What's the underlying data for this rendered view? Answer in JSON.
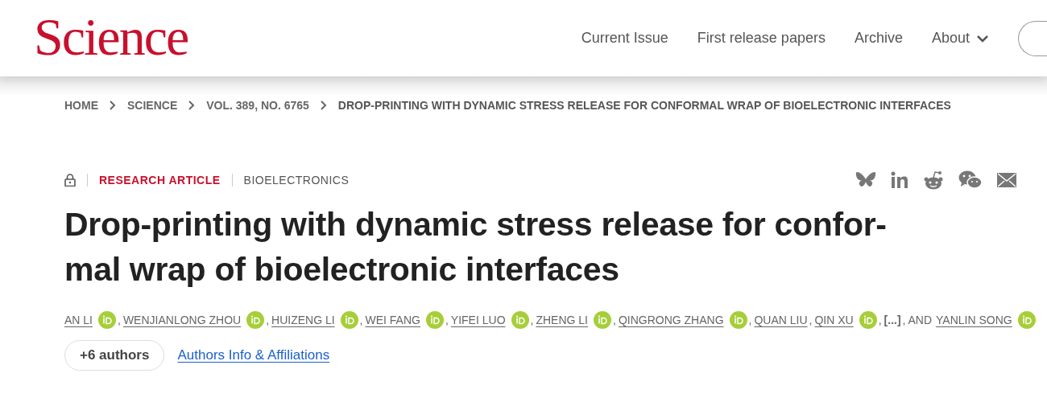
{
  "header": {
    "logo": "Science",
    "nav": [
      {
        "label": "Current Issue",
        "dropdown": false
      },
      {
        "label": "First release papers",
        "dropdown": false
      },
      {
        "label": "Archive",
        "dropdown": false
      },
      {
        "label": "About",
        "dropdown": true
      }
    ]
  },
  "breadcrumb": [
    "HOME",
    "SCIENCE",
    "VOL. 389, NO. 6765",
    "DROP-PRINTING WITH DYNAMIC STRESS RELEASE FOR CONFORMAL WRAP OF BIOELECTRONIC INTERFACES"
  ],
  "article": {
    "locked": true,
    "type": "RESEARCH ARTICLE",
    "section": "BIOELECTRONICS",
    "share": [
      {
        "kind": "bluesky"
      },
      {
        "kind": "linkedin"
      },
      {
        "kind": "reddit"
      },
      {
        "kind": "wechat"
      },
      {
        "kind": "email"
      }
    ],
    "title_lines": [
      "Drop-printing with dynamic stress release for confor-",
      "mal wrap of bioelectronic interfaces"
    ],
    "authors": [
      {
        "kind": "author",
        "name": "AN LI",
        "orcid": true,
        "sep": ","
      },
      {
        "kind": "author",
        "name": "WENJIANLONG ZHOU",
        "orcid": true,
        "sep": ","
      },
      {
        "kind": "author",
        "name": "HUIZENG LI",
        "orcid": true,
        "sep": ","
      },
      {
        "kind": "author",
        "name": "WEI FANG",
        "orcid": true,
        "sep": ","
      },
      {
        "kind": "author",
        "name": "YIFEI LUO",
        "orcid": true,
        "sep": ","
      },
      {
        "kind": "author",
        "name": "ZHENG LI",
        "orcid": true,
        "sep": ","
      },
      {
        "kind": "author",
        "name": "QINGRONG ZHANG",
        "orcid": true,
        "sep": ","
      },
      {
        "kind": "author",
        "name": "QUAN LIU",
        "orcid": false,
        "sep": ","
      },
      {
        "kind": "author",
        "name": "QIN XU",
        "orcid": true,
        "sep": ","
      },
      {
        "kind": "ellipsis",
        "name": "[...]",
        "sep": ","
      },
      {
        "kind": "conjunction",
        "name": "AND"
      },
      {
        "kind": "author",
        "name": "YANLIN SONG",
        "orcid": true
      }
    ],
    "more_authors": "+6 authors",
    "affiliations_link": "Authors Info & Affiliations"
  }
}
